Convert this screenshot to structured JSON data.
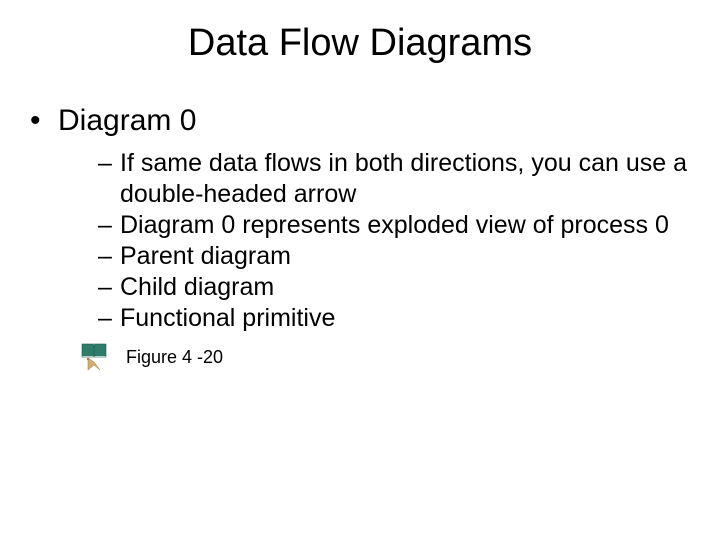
{
  "title": "Data Flow Diagrams",
  "lvl1": {
    "a": "Diagram 0"
  },
  "lvl2": {
    "a": "If same data flows in both directions, you can use a double-headed arrow",
    "b": "Diagram 0 represents exploded view of process 0",
    "c": "Parent diagram",
    "d": "Child diagram",
    "e": "Functional primitive"
  },
  "figure": {
    "label": "Figure 4 -20"
  },
  "icons": {
    "figure": "book-pointer-icon"
  },
  "colors": {
    "book": "#2e7d6b",
    "pointer": "#d2b06a",
    "text": "#000000"
  }
}
